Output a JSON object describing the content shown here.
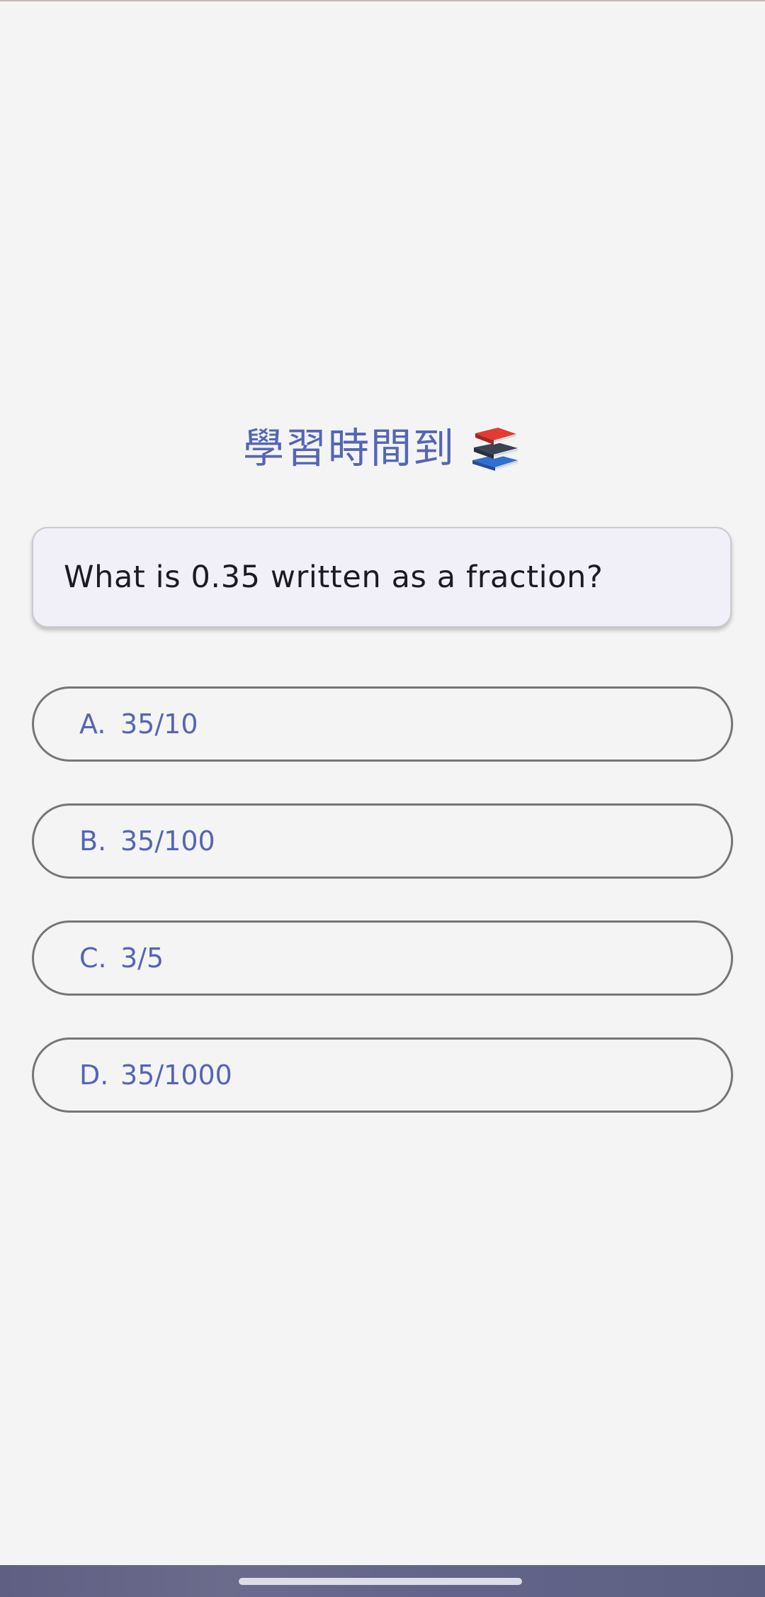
{
  "header": {
    "title": "學習時間到",
    "title_icon": "books-emoji-icon"
  },
  "question": {
    "text": "What is 0.35 written as a fraction?"
  },
  "options": [
    {
      "letter": "A.",
      "value": "35/10"
    },
    {
      "letter": "B.",
      "value": "35/100"
    },
    {
      "letter": "C.",
      "value": "3/5"
    },
    {
      "letter": "D.",
      "value": "35/1000"
    }
  ],
  "colors": {
    "accent": "#5565b6",
    "background": "#f4f4f4",
    "card": "#f1eff8",
    "outline": "#76757a",
    "text": "#1c1b1f"
  }
}
